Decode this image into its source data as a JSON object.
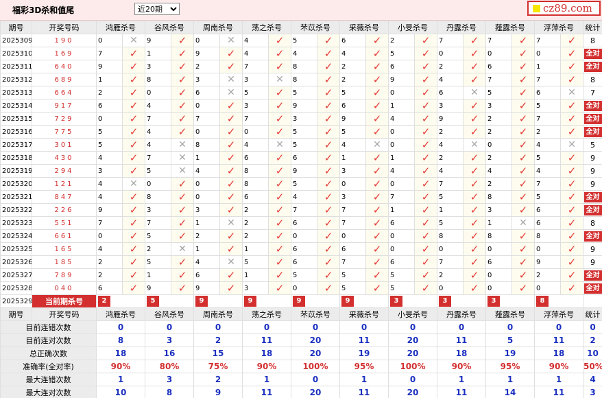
{
  "header": {
    "title": "福彩3D杀和值尾",
    "period_select": "近20期",
    "brand": "cz89.com"
  },
  "columns": {
    "issue": "期号",
    "draw": "开奖号码",
    "experts": [
      "鸿雁杀号",
      "谷风杀号",
      "周南杀号",
      "荡之杀号",
      "芣苡杀号",
      "采薇杀号",
      "小旻杀号",
      "丹露杀号",
      "薤露杀号",
      "浮萍杀号"
    ],
    "stat": "统计"
  },
  "rows": [
    {
      "issue": "2025309",
      "draw": "190",
      "kills": [
        [
          0,
          0
        ],
        [
          9,
          1
        ],
        [
          0,
          0
        ],
        [
          4,
          1
        ],
        [
          5,
          1
        ],
        [
          6,
          1
        ],
        [
          2,
          1
        ],
        [
          7,
          1
        ],
        [
          7,
          1
        ],
        [
          7,
          1
        ]
      ],
      "stat": "8"
    },
    {
      "issue": "2025310",
      "draw": "169",
      "kills": [
        [
          7,
          1
        ],
        [
          1,
          1
        ],
        [
          9,
          1
        ],
        [
          4,
          1
        ],
        [
          4,
          1
        ],
        [
          4,
          1
        ],
        [
          5,
          1
        ],
        [
          0,
          1
        ],
        [
          0,
          1
        ],
        [
          0,
          1
        ]
      ],
      "stat": "全对"
    },
    {
      "issue": "2025311",
      "draw": "640",
      "kills": [
        [
          9,
          1
        ],
        [
          3,
          1
        ],
        [
          2,
          1
        ],
        [
          7,
          1
        ],
        [
          8,
          1
        ],
        [
          2,
          1
        ],
        [
          6,
          1
        ],
        [
          2,
          1
        ],
        [
          6,
          1
        ],
        [
          1,
          1
        ]
      ],
      "stat": "全对"
    },
    {
      "issue": "2025312",
      "draw": "689",
      "kills": [
        [
          1,
          1
        ],
        [
          8,
          1
        ],
        [
          3,
          0
        ],
        [
          3,
          0
        ],
        [
          8,
          1
        ],
        [
          2,
          1
        ],
        [
          9,
          1
        ],
        [
          4,
          1
        ],
        [
          7,
          1
        ],
        [
          7,
          1
        ]
      ],
      "stat": "8"
    },
    {
      "issue": "2025313",
      "draw": "664",
      "kills": [
        [
          2,
          1
        ],
        [
          0,
          1
        ],
        [
          6,
          0
        ],
        [
          5,
          1
        ],
        [
          5,
          1
        ],
        [
          5,
          1
        ],
        [
          0,
          1
        ],
        [
          6,
          0
        ],
        [
          5,
          1
        ],
        [
          6,
          0
        ]
      ],
      "stat": "7"
    },
    {
      "issue": "2025314",
      "draw": "917",
      "kills": [
        [
          6,
          1
        ],
        [
          4,
          1
        ],
        [
          0,
          1
        ],
        [
          3,
          1
        ],
        [
          9,
          1
        ],
        [
          6,
          1
        ],
        [
          1,
          1
        ],
        [
          3,
          1
        ],
        [
          3,
          1
        ],
        [
          5,
          1
        ]
      ],
      "stat": "全对"
    },
    {
      "issue": "2025315",
      "draw": "729",
      "kills": [
        [
          0,
          1
        ],
        [
          7,
          1
        ],
        [
          7,
          1
        ],
        [
          7,
          1
        ],
        [
          3,
          1
        ],
        [
          9,
          1
        ],
        [
          4,
          1
        ],
        [
          9,
          1
        ],
        [
          2,
          1
        ],
        [
          7,
          1
        ]
      ],
      "stat": "全对"
    },
    {
      "issue": "2025316",
      "draw": "775",
      "kills": [
        [
          5,
          1
        ],
        [
          4,
          1
        ],
        [
          0,
          1
        ],
        [
          0,
          1
        ],
        [
          5,
          1
        ],
        [
          5,
          1
        ],
        [
          0,
          1
        ],
        [
          2,
          1
        ],
        [
          2,
          1
        ],
        [
          2,
          1
        ]
      ],
      "stat": "全对"
    },
    {
      "issue": "2025317",
      "draw": "301",
      "kills": [
        [
          5,
          1
        ],
        [
          4,
          0
        ],
        [
          8,
          1
        ],
        [
          4,
          0
        ],
        [
          5,
          1
        ],
        [
          4,
          0
        ],
        [
          0,
          1
        ],
        [
          4,
          0
        ],
        [
          0,
          1
        ],
        [
          4,
          0
        ]
      ],
      "stat": "5"
    },
    {
      "issue": "2025318",
      "draw": "430",
      "kills": [
        [
          4,
          1
        ],
        [
          7,
          0
        ],
        [
          1,
          1
        ],
        [
          6,
          1
        ],
        [
          6,
          1
        ],
        [
          1,
          1
        ],
        [
          1,
          1
        ],
        [
          2,
          1
        ],
        [
          2,
          1
        ],
        [
          5,
          1
        ]
      ],
      "stat": "9"
    },
    {
      "issue": "2025319",
      "draw": "294",
      "kills": [
        [
          3,
          1
        ],
        [
          5,
          0
        ],
        [
          4,
          1
        ],
        [
          8,
          1
        ],
        [
          9,
          1
        ],
        [
          3,
          1
        ],
        [
          4,
          1
        ],
        [
          4,
          1
        ],
        [
          4,
          1
        ],
        [
          4,
          1
        ]
      ],
      "stat": "9"
    },
    {
      "issue": "2025320",
      "draw": "121",
      "kills": [
        [
          4,
          0
        ],
        [
          0,
          1
        ],
        [
          0,
          1
        ],
        [
          8,
          1
        ],
        [
          5,
          1
        ],
        [
          0,
          1
        ],
        [
          0,
          1
        ],
        [
          7,
          1
        ],
        [
          2,
          1
        ],
        [
          7,
          1
        ]
      ],
      "stat": "9"
    },
    {
      "issue": "2025321",
      "draw": "847",
      "kills": [
        [
          4,
          1
        ],
        [
          8,
          1
        ],
        [
          0,
          1
        ],
        [
          6,
          1
        ],
        [
          4,
          1
        ],
        [
          3,
          1
        ],
        [
          7,
          1
        ],
        [
          5,
          1
        ],
        [
          8,
          1
        ],
        [
          5,
          1
        ]
      ],
      "stat": "全对"
    },
    {
      "issue": "2025322",
      "draw": "226",
      "kills": [
        [
          9,
          1
        ],
        [
          3,
          1
        ],
        [
          3,
          1
        ],
        [
          2,
          1
        ],
        [
          7,
          1
        ],
        [
          7,
          1
        ],
        [
          1,
          1
        ],
        [
          1,
          1
        ],
        [
          3,
          1
        ],
        [
          6,
          1
        ]
      ],
      "stat": "全对"
    },
    {
      "issue": "2025323",
      "draw": "551",
      "kills": [
        [
          7,
          1
        ],
        [
          7,
          1
        ],
        [
          1,
          0
        ],
        [
          2,
          1
        ],
        [
          6,
          1
        ],
        [
          7,
          1
        ],
        [
          6,
          1
        ],
        [
          5,
          1
        ],
        [
          1,
          0
        ],
        [
          6,
          1
        ]
      ],
      "stat": "8"
    },
    {
      "issue": "2025324",
      "draw": "661",
      "kills": [
        [
          0,
          1
        ],
        [
          5,
          1
        ],
        [
          2,
          1
        ],
        [
          2,
          1
        ],
        [
          0,
          1
        ],
        [
          0,
          1
        ],
        [
          0,
          1
        ],
        [
          8,
          1
        ],
        [
          8,
          1
        ],
        [
          8,
          1
        ]
      ],
      "stat": "全对"
    },
    {
      "issue": "2025325",
      "draw": "165",
      "kills": [
        [
          4,
          1
        ],
        [
          2,
          0
        ],
        [
          1,
          1
        ],
        [
          1,
          1
        ],
        [
          6,
          1
        ],
        [
          6,
          1
        ],
        [
          0,
          1
        ],
        [
          0,
          1
        ],
        [
          0,
          1
        ],
        [
          0,
          1
        ]
      ],
      "stat": "9"
    },
    {
      "issue": "2025326",
      "draw": "185",
      "kills": [
        [
          2,
          1
        ],
        [
          5,
          1
        ],
        [
          4,
          0
        ],
        [
          5,
          1
        ],
        [
          6,
          1
        ],
        [
          7,
          1
        ],
        [
          6,
          1
        ],
        [
          7,
          1
        ],
        [
          6,
          1
        ],
        [
          9,
          1
        ]
      ],
      "stat": "9"
    },
    {
      "issue": "2025327",
      "draw": "789",
      "kills": [
        [
          2,
          1
        ],
        [
          1,
          1
        ],
        [
          6,
          1
        ],
        [
          1,
          1
        ],
        [
          5,
          1
        ],
        [
          5,
          1
        ],
        [
          5,
          1
        ],
        [
          2,
          1
        ],
        [
          0,
          1
        ],
        [
          2,
          1
        ]
      ],
      "stat": "全对"
    },
    {
      "issue": "2025328",
      "draw": "040",
      "kills": [
        [
          6,
          1
        ],
        [
          9,
          1
        ],
        [
          9,
          1
        ],
        [
          3,
          1
        ],
        [
          0,
          1
        ],
        [
          5,
          1
        ],
        [
          5,
          1
        ],
        [
          0,
          1
        ],
        [
          0,
          1
        ],
        [
          0,
          1
        ]
      ],
      "stat": "全对"
    }
  ],
  "current": {
    "issue": "2025329",
    "label": "当前期杀号",
    "kills": [
      "2",
      "5",
      "9",
      "9",
      "9",
      "9",
      "3",
      "3",
      "3",
      "8"
    ]
  },
  "summary": [
    {
      "label": "目前连错次数",
      "values": [
        "0",
        "0",
        "0",
        "0",
        "0",
        "0",
        "0",
        "0",
        "0",
        "0",
        "0"
      ],
      "red": false
    },
    {
      "label": "目前连对次数",
      "values": [
        "8",
        "3",
        "2",
        "11",
        "20",
        "11",
        "20",
        "11",
        "5",
        "11",
        "2"
      ],
      "red": false
    },
    {
      "label": "总正确次数",
      "values": [
        "18",
        "16",
        "15",
        "18",
        "20",
        "19",
        "20",
        "18",
        "19",
        "18",
        "10"
      ],
      "red": false
    },
    {
      "label": "准确率(全对率)",
      "values": [
        "90%",
        "80%",
        "75%",
        "90%",
        "100%",
        "95%",
        "100%",
        "90%",
        "95%",
        "90%",
        "50%"
      ],
      "red": true
    },
    {
      "label": "最大连错次数",
      "values": [
        "1",
        "3",
        "2",
        "1",
        "0",
        "1",
        "0",
        "1",
        "1",
        "1",
        "4"
      ],
      "red": false
    },
    {
      "label": "最大连对次数",
      "values": [
        "10",
        "8",
        "9",
        "11",
        "20",
        "11",
        "20",
        "11",
        "14",
        "11",
        "3"
      ],
      "red": false
    }
  ],
  "colors": {
    "accent": "#d32f2f",
    "header_bg": "#ececec",
    "stat_blue": "#1a2fbf",
    "tick": "#e53935",
    "cross": "#a7a7a7"
  }
}
